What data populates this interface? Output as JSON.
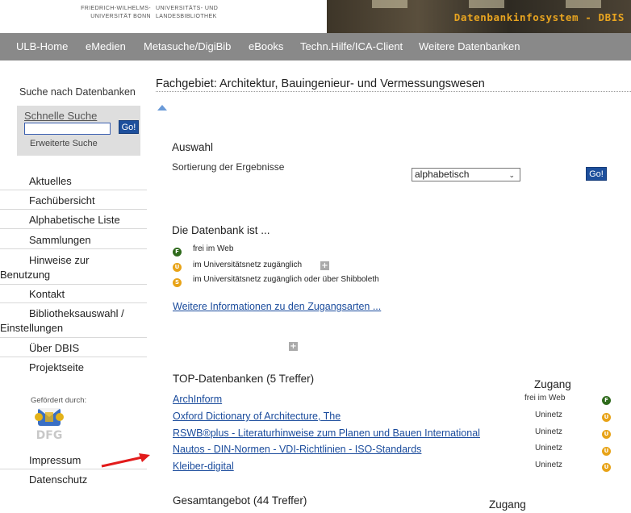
{
  "header": {
    "logo_left_line1": "FRIEDRICH-WILHELMS-",
    "logo_left_line2": "UNIVERSITÄT BONN",
    "logo_right_line1": "UNIVERSITÄTS- UND",
    "logo_right_line2": "LANDESBIBLIOTHEK",
    "banner_title": "Datenbankinfosystem - DBIS"
  },
  "topnav": [
    "ULB-Home",
    "eMedien",
    "Metasuche/DigiBib",
    "eBooks",
    "Techn.Hilfe/ICA-Client",
    "Weitere Datenbanken"
  ],
  "sidebar": {
    "heading": "Suche nach Datenbanken",
    "quick_label": "Schnelle Suche",
    "quick_input_value": "",
    "go_label": "Go!",
    "advanced_label": "Erweiterte Suche",
    "items": [
      {
        "line1": "Aktuelles",
        "line2": ""
      },
      {
        "line1": "Fachübersicht",
        "line2": ""
      },
      {
        "line1": "Alphabetische Liste",
        "line2": ""
      },
      {
        "line1": "Sammlungen",
        "line2": ""
      },
      {
        "line1": "Hinweise zur",
        "line2": "Benutzung"
      },
      {
        "line1": "Kontakt",
        "line2": ""
      },
      {
        "line1": "Bibliotheksauswahl /",
        "line2": "Einstellungen"
      },
      {
        "line1": "Über DBIS",
        "line2": ""
      },
      {
        "line1": "Projektseite",
        "line2": ""
      }
    ],
    "sponsor_label": "Gefördert durch:",
    "sponsor_logo_text": "DFG",
    "bottom_items": [
      "Impressum",
      "Datenschutz"
    ]
  },
  "main": {
    "title": "Fachgebiet: Architektur, Bauingenieur- und Vermessungswesen",
    "auswahl_heading": "Auswahl",
    "sort_label": "Sortierung der Ergebnisse",
    "sort_value": "alphabetisch",
    "go_label": "Go!",
    "legend_heading": "Die Datenbank ist ...",
    "legend": [
      {
        "badge": "F",
        "color": "green",
        "text": "frei im Web"
      },
      {
        "badge": "U",
        "color": "orange",
        "text": "im Universitätsnetz zugänglich"
      },
      {
        "badge": "S",
        "color": "orange",
        "text": "im Universitätsnetz zugänglich oder über Shibboleth"
      }
    ],
    "more_info_link": "Weitere Informationen zu den Zugangsarten ...",
    "top_heading": "TOP-Datenbanken (5 Treffer)",
    "access_heading": "Zugang",
    "top_databases": [
      {
        "name": "ArchInform",
        "access": "frei im Web",
        "badge": "F",
        "color": "green"
      },
      {
        "name": "Oxford Dictionary of Architecture, The",
        "access": "Uninetz",
        "badge": "U",
        "color": "orange"
      },
      {
        "name": "RSWB®plus - Literaturhinweise zum Planen und Bauen International",
        "access": "Uninetz",
        "badge": "U",
        "color": "orange"
      },
      {
        "name": "Nautos - DIN-Normen - VDI-Richtlinien - ISO-Standards",
        "access": "Uninetz",
        "badge": "U",
        "color": "orange"
      },
      {
        "name": "Kleiber-digital",
        "access": "Uninetz",
        "badge": "U",
        "color": "orange"
      }
    ],
    "total_heading": "Gesamtangebot (44 Treffer)",
    "total_access_heading": "Zugang"
  },
  "colors": {
    "nav_bg": "#898989",
    "link": "#1a4b9c",
    "go_button": "#1d4f9c",
    "banner_text": "#e9a520",
    "badge_green": "#2f6a1c",
    "badge_orange": "#e8a317",
    "annotation_arrow": "#e21b1b"
  }
}
